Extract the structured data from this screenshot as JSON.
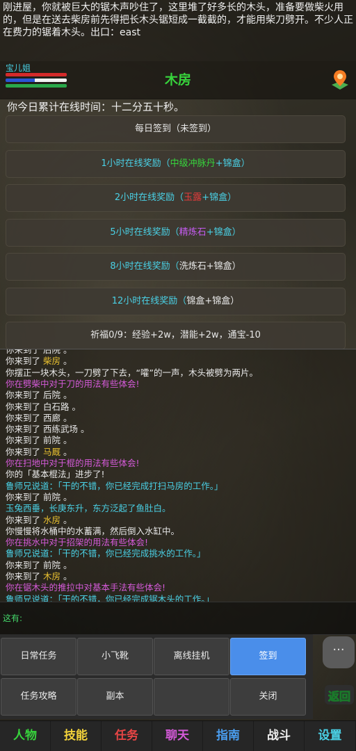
{
  "description": "刚进屋，你就被巨大的锯木声吵住了，这里堆了好多长的木头，准备要做柴火用的，但是在送去柴房前先得把长木头锯短成一截截的，才能用柴刀劈开。不少人正在费力的锯着木头。出口：east",
  "player": {
    "name": "宝儿姐",
    "colors": {
      "hp": "#d42a2a",
      "mp": "#2a55d4"
    }
  },
  "room": {
    "name": "木房",
    "map_icon": "map-pin-icon"
  },
  "online_time": "你今日累计在线时间：十二分五十秒。",
  "rewards": [
    {
      "parts": [
        {
          "t": "每日签到（未签到）",
          "c": "#e8e8e8"
        }
      ]
    },
    {
      "parts": [
        {
          "t": "1小时在线奖励（",
          "c": "#4ad1e6"
        },
        {
          "t": "中级冲脉丹",
          "c": "#37d43c"
        },
        {
          "t": "+锦盒）",
          "c": "#4ad1e6"
        }
      ]
    },
    {
      "parts": [
        {
          "t": "2小时在线奖励（",
          "c": "#4ad1e6"
        },
        {
          "t": "玉露",
          "c": "#e23b3b"
        },
        {
          "t": "+锦盒）",
          "c": "#4ad1e6"
        }
      ]
    },
    {
      "parts": [
        {
          "t": "5小时在线奖励（",
          "c": "#4ad1e6"
        },
        {
          "t": "精炼石",
          "c": "#c45cf0"
        },
        {
          "t": "+锦盒）",
          "c": "#4ad1e6"
        }
      ]
    },
    {
      "parts": [
        {
          "t": "8小时在线奖励（",
          "c": "#4ad1e6"
        },
        {
          "t": "洗炼石+锦盒）",
          "c": "#e8e8e8"
        }
      ]
    },
    {
      "parts": [
        {
          "t": "12小时在线奖励（",
          "c": "#4ad1e6"
        },
        {
          "t": "锦盒+锦盒）",
          "c": "#e8e8e8"
        }
      ]
    },
    {
      "parts": [
        {
          "t": "祈福0/9：经验+2w，潜能+2w，通宝-10",
          "c": "#e8e8e8"
        }
      ]
    }
  ],
  "log": [
    {
      "parts": [
        {
          "t": "你来到了 后院 。",
          "c": "#e8e8e8"
        }
      ]
    },
    {
      "parts": [
        {
          "t": "你来到了 ",
          "c": "#e8e8e8"
        },
        {
          "t": "柴房",
          "c": "#e8c030"
        },
        {
          "t": " 。",
          "c": "#e8e8e8"
        }
      ]
    },
    {
      "parts": [
        {
          "t": "你摆正一块木头，一刀劈了下去，“嚯”的一声，木头被劈为两片。",
          "c": "#e8e8e8"
        }
      ]
    },
    {
      "parts": [
        {
          "t": "你在劈柴中对于刀的用法有些体会!",
          "c": "#d45ad8"
        }
      ]
    },
    {
      "parts": [
        {
          "t": "你来到了 后院 。",
          "c": "#e8e8e8"
        }
      ]
    },
    {
      "parts": [
        {
          "t": "你来到了 白石路 。",
          "c": "#e8e8e8"
        }
      ]
    },
    {
      "parts": [
        {
          "t": "你来到了 西廊 。",
          "c": "#e8e8e8"
        }
      ]
    },
    {
      "parts": [
        {
          "t": "你来到了 西练武场 。",
          "c": "#e8e8e8"
        }
      ]
    },
    {
      "parts": [
        {
          "t": "你来到了 前院 。",
          "c": "#e8e8e8"
        }
      ]
    },
    {
      "parts": [
        {
          "t": "你来到了 ",
          "c": "#e8e8e8"
        },
        {
          "t": "马厩",
          "c": "#e8c030"
        },
        {
          "t": " 。",
          "c": "#e8e8e8"
        }
      ]
    },
    {
      "parts": [
        {
          "t": "你在扫地中对于棍的用法有些体会!",
          "c": "#d45ad8"
        }
      ]
    },
    {
      "parts": [
        {
          "t": "你的「基本棍法」进步了!",
          "c": "#e8e8e8"
        }
      ]
    },
    {
      "parts": [
        {
          "t": "鲁师兄说道：「干的不错，你已经完成打扫马房的工作。」",
          "c": "#4ad1e6"
        }
      ]
    },
    {
      "parts": [
        {
          "t": "你来到了 前院 。",
          "c": "#e8e8e8"
        }
      ]
    },
    {
      "parts": [
        {
          "t": "玉兔西垂，长庚东升，东方泛起了鱼肚白。",
          "c": "#4ad1e6"
        }
      ]
    },
    {
      "parts": [
        {
          "t": "你来到了 ",
          "c": "#e8e8e8"
        },
        {
          "t": "水房",
          "c": "#e8c030"
        },
        {
          "t": " 。",
          "c": "#e8e8e8"
        }
      ]
    },
    {
      "parts": [
        {
          "t": "你慢慢将水桶中的水蓄满，然后倒入水缸中。",
          "c": "#e8e8e8"
        }
      ]
    },
    {
      "parts": [
        {
          "t": "你在挑水中对于招架的用法有些体会!",
          "c": "#d45ad8"
        }
      ]
    },
    {
      "parts": [
        {
          "t": "鲁师兄说道：「干的不错，你已经完成挑水的工作。」",
          "c": "#4ad1e6"
        }
      ]
    },
    {
      "parts": [
        {
          "t": "你来到了 前院 。",
          "c": "#e8e8e8"
        }
      ]
    },
    {
      "parts": [
        {
          "t": "你来到了 ",
          "c": "#e8e8e8"
        },
        {
          "t": "木房",
          "c": "#e8c030"
        },
        {
          "t": " 。",
          "c": "#e8e8e8"
        }
      ]
    },
    {
      "parts": [
        {
          "t": "你在锯木头的推拉中对基本手法有些体会!",
          "c": "#d45ad8"
        }
      ]
    },
    {
      "parts": [
        {
          "t": "鲁师兄说道：「干的不错，你已经完成锯木头的工作。」",
          "c": "#4ad1e6"
        }
      ]
    }
  ],
  "input": {
    "label": "这有:"
  },
  "menu": [
    {
      "label": "日常任务",
      "active": false
    },
    {
      "label": "小飞靴",
      "active": false
    },
    {
      "label": "离线挂机",
      "active": false
    },
    {
      "label": "签到",
      "active": true
    },
    {
      "label": "任务攻略",
      "active": false
    },
    {
      "label": "副本",
      "active": false
    },
    {
      "label": "",
      "active": false
    },
    {
      "label": "关闭",
      "active": false
    }
  ],
  "more_button": "···",
  "return_label": "返回",
  "tabs": [
    {
      "label": "人物",
      "color": "#37d43c"
    },
    {
      "label": "技能",
      "color": "#f2d23a"
    },
    {
      "label": "任务",
      "color": "#e64545"
    },
    {
      "label": "聊天",
      "color": "#d45ad8"
    },
    {
      "label": "指南",
      "color": "#4a9ef0"
    },
    {
      "label": "战斗",
      "color": "#f0f0f0"
    },
    {
      "label": "设置",
      "color": "#4ad1e6"
    }
  ]
}
